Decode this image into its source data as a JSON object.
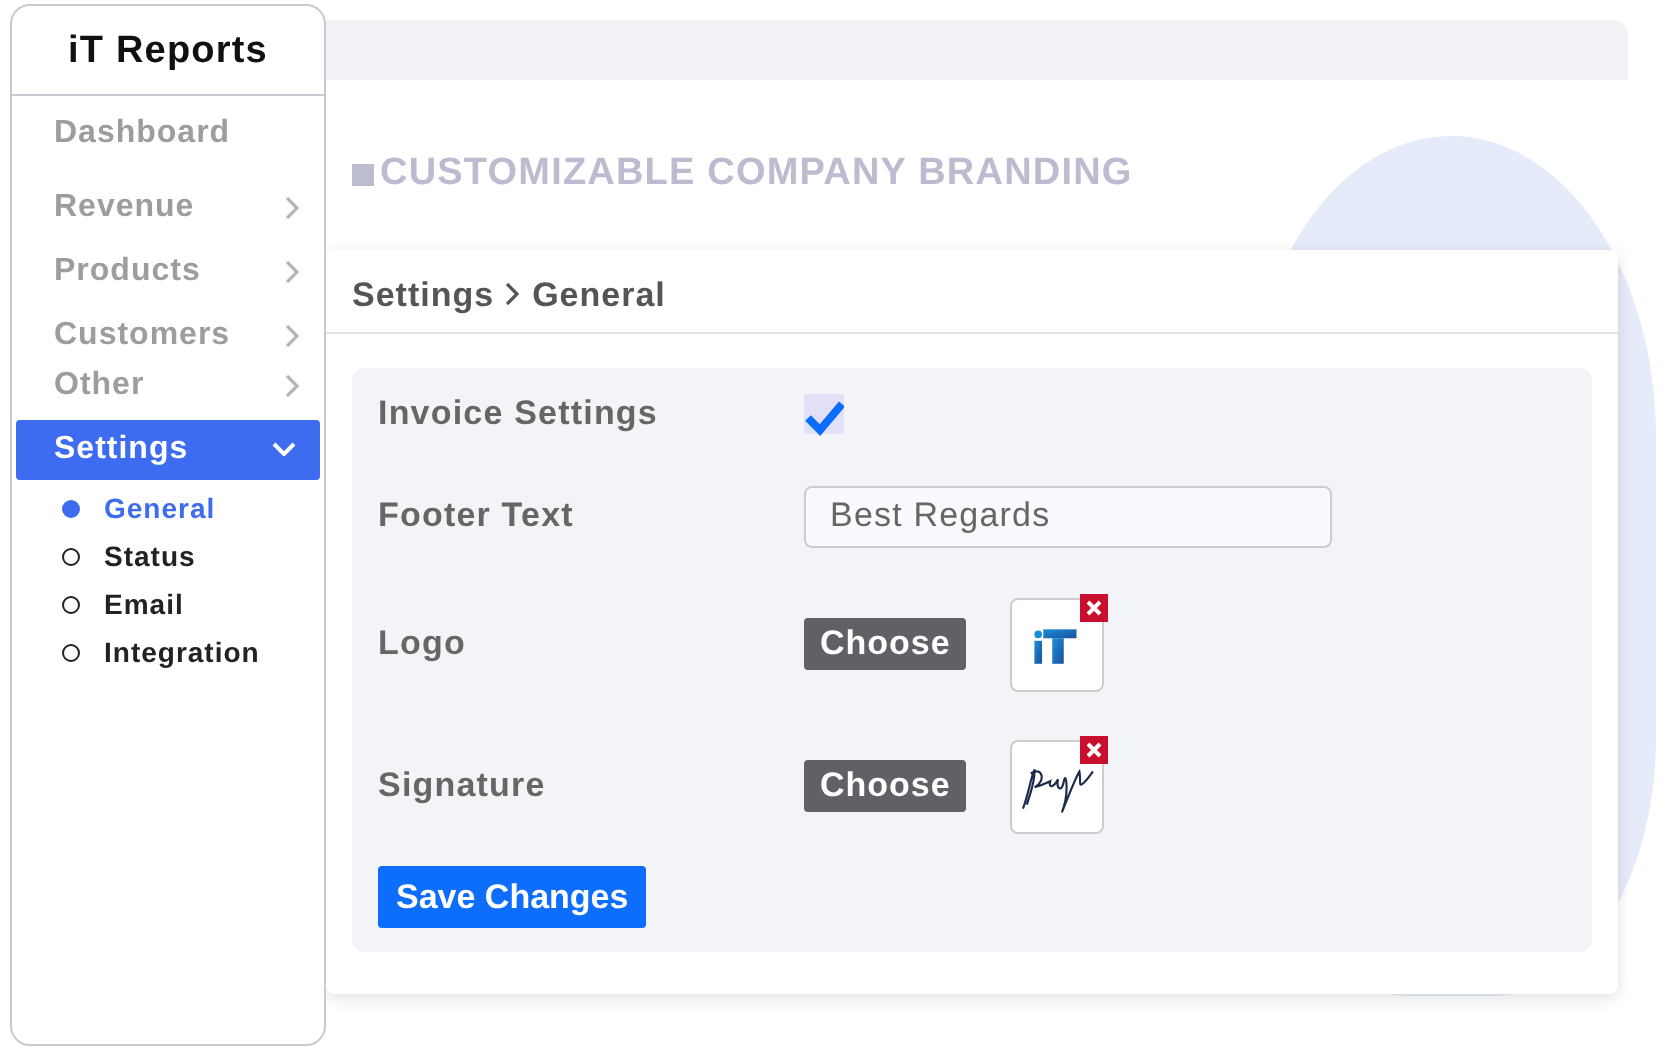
{
  "app": {
    "title": "iT Reports"
  },
  "sidebar": {
    "items": [
      {
        "label": "Dashboard",
        "kind": "link",
        "selected": false
      },
      {
        "label": "Revenue",
        "kind": "menu",
        "selected": false,
        "expanded": false
      },
      {
        "label": "Products",
        "kind": "menu",
        "selected": false,
        "expanded": false
      },
      {
        "label": "Customers",
        "kind": "menu",
        "selected": false,
        "expanded": false
      },
      {
        "label": "Other",
        "kind": "menu",
        "selected": false,
        "expanded": false
      },
      {
        "label": "Settings",
        "kind": "menu",
        "selected": true,
        "expanded": true,
        "children": [
          {
            "label": "General",
            "selected": true
          },
          {
            "label": "Status",
            "selected": false
          },
          {
            "label": "Email",
            "selected": false
          },
          {
            "label": "Integration",
            "selected": false
          }
        ]
      }
    ]
  },
  "banner": "CUSTOMIZABLE COMPANY BRANDING",
  "breadcrumb": [
    "Settings",
    "General"
  ],
  "form": {
    "rows": [
      {
        "kind": "checkbox",
        "label": "Invoice Settings",
        "checked": true
      },
      {
        "kind": "text",
        "label": "Footer Text",
        "value": "Best Regards"
      },
      {
        "kind": "upload",
        "label": "Logo",
        "button": "Choose",
        "thumbnail": {
          "kind": "logo"
        }
      },
      {
        "kind": "upload",
        "label": "Signature",
        "button": "Choose",
        "thumbnail": {
          "kind": "signature"
        }
      }
    ],
    "submit": "Save Changes"
  }
}
